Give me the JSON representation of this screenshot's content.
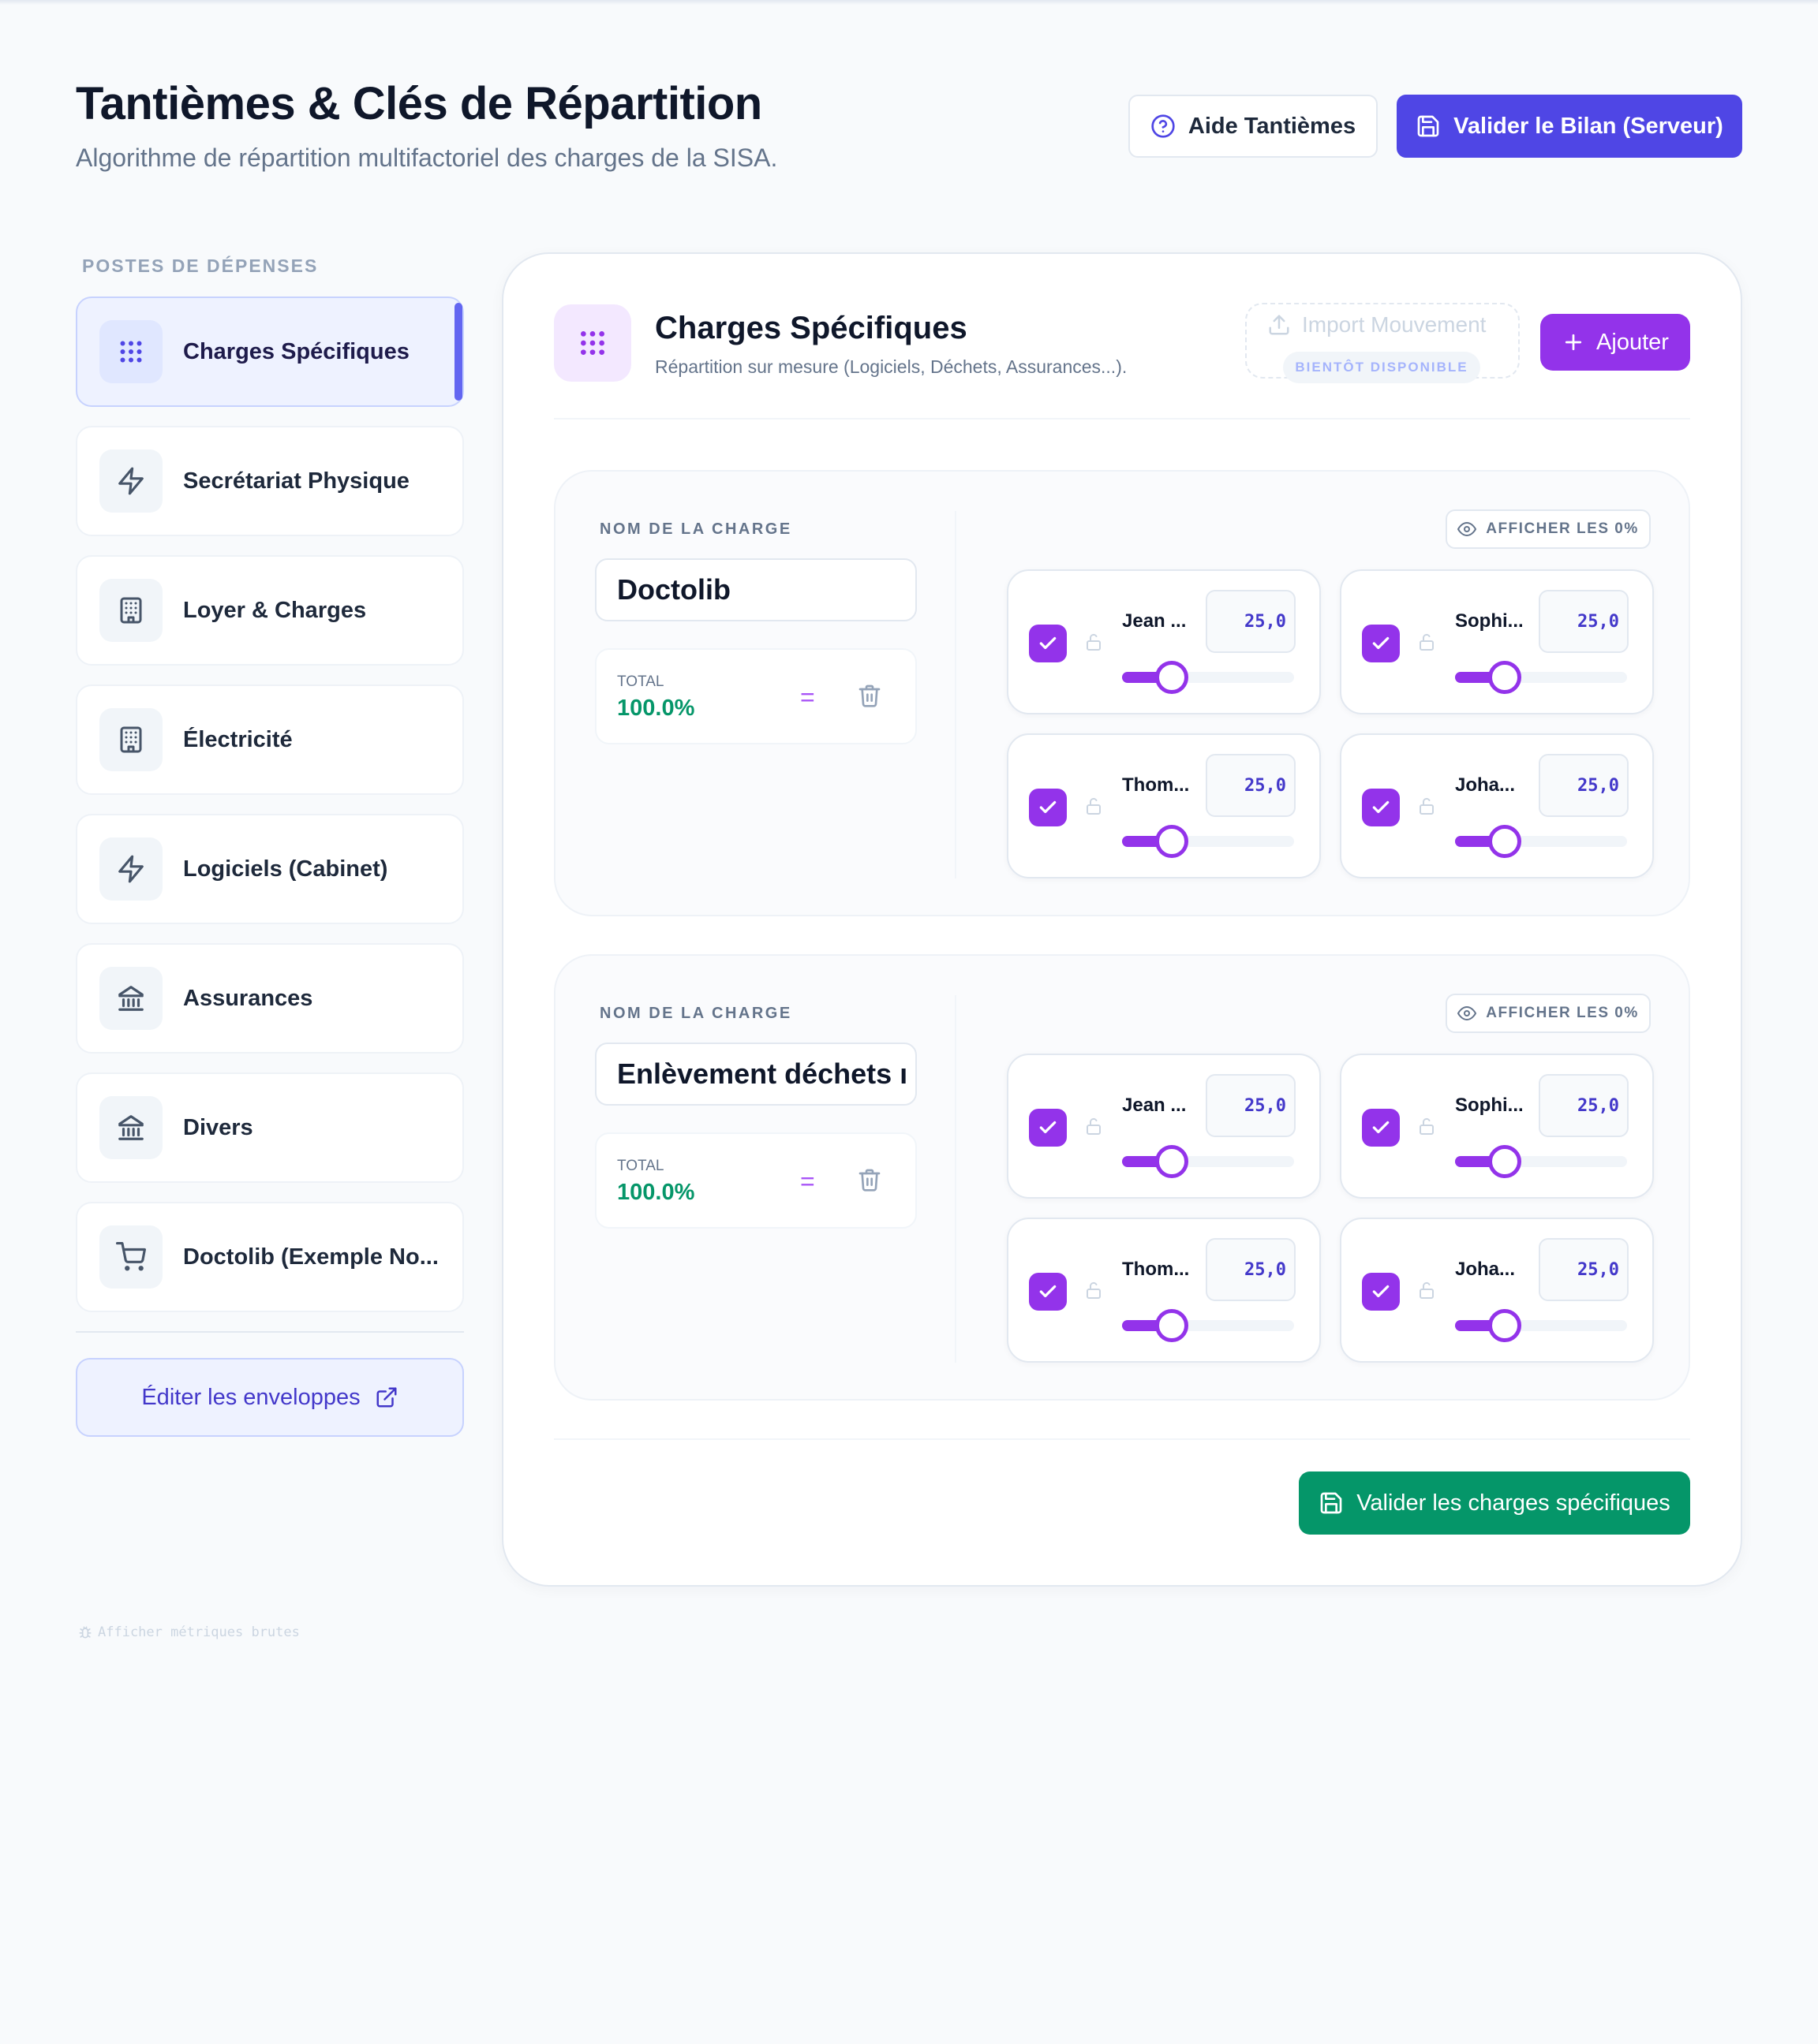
{
  "header": {
    "title": "Tantièmes & Clés de Répartition",
    "subtitle": "Algorithme de répartition multifactoriel des charges de la SISA.",
    "help_button": "Aide Tantièmes",
    "validate_button": "Valider le Bilan (Serveur)"
  },
  "sidebar": {
    "section_label": "POSTES DE DÉPENSES",
    "items": [
      {
        "label": "Charges Spécifiques",
        "icon": "grid-dots-icon",
        "active": true
      },
      {
        "label": "Secrétariat Physique",
        "icon": "bolt-icon",
        "active": false
      },
      {
        "label": "Loyer & Charges",
        "icon": "building-icon",
        "active": false
      },
      {
        "label": "Électricité",
        "icon": "building-icon",
        "active": false
      },
      {
        "label": "Logiciels (Cabinet)",
        "icon": "bolt-icon",
        "active": false
      },
      {
        "label": "Assurances",
        "icon": "bank-icon",
        "active": false
      },
      {
        "label": "Divers",
        "icon": "bank-icon",
        "active": false
      },
      {
        "label": "Doctolib (Exemple No...",
        "icon": "cart-icon",
        "active": false
      }
    ],
    "edit_envelopes_button": "Éditer les enveloppes",
    "raw_metrics_link": "Afficher métriques brutes"
  },
  "main": {
    "title": "Charges Spécifiques",
    "subtitle": "Répartition sur mesure (Logiciels, Déchets, Assurances...).",
    "import_label": "Import Mouvement",
    "soon_badge": "BIENTÔT DISPONIBLE",
    "add_button": "Ajouter",
    "save_button": "Valider les charges spécifiques",
    "charges": [
      {
        "name_label": "NOM DE LA CHARGE",
        "name": "Doctolib",
        "total_label": "TOTAL",
        "total": "100.0%",
        "show_zero_button": "AFFICHER LES 0%",
        "members": [
          {
            "name": "Jean ...",
            "value": "25,0",
            "checked": true,
            "share": 25
          },
          {
            "name": "Sophi...",
            "value": "25,0",
            "checked": true,
            "share": 25
          },
          {
            "name": "Thom...",
            "value": "25,0",
            "checked": true,
            "share": 25
          },
          {
            "name": "Joha...",
            "value": "25,0",
            "checked": true,
            "share": 25
          }
        ]
      },
      {
        "name_label": "NOM DE LA CHARGE",
        "name": "Enlèvement déchets ı",
        "total_label": "TOTAL",
        "total": "100.0%",
        "show_zero_button": "AFFICHER LES 0%",
        "members": [
          {
            "name": "Jean ...",
            "value": "25,0",
            "checked": true,
            "share": 25
          },
          {
            "name": "Sophi...",
            "value": "25,0",
            "checked": true,
            "share": 25
          },
          {
            "name": "Thom...",
            "value": "25,0",
            "checked": true,
            "share": 25
          },
          {
            "name": "Joha...",
            "value": "25,0",
            "checked": true,
            "share": 25
          }
        ]
      }
    ]
  },
  "colors": {
    "primary_indigo": "#4f46e5",
    "accent_purple": "#9333ea",
    "success_green": "#059669"
  }
}
